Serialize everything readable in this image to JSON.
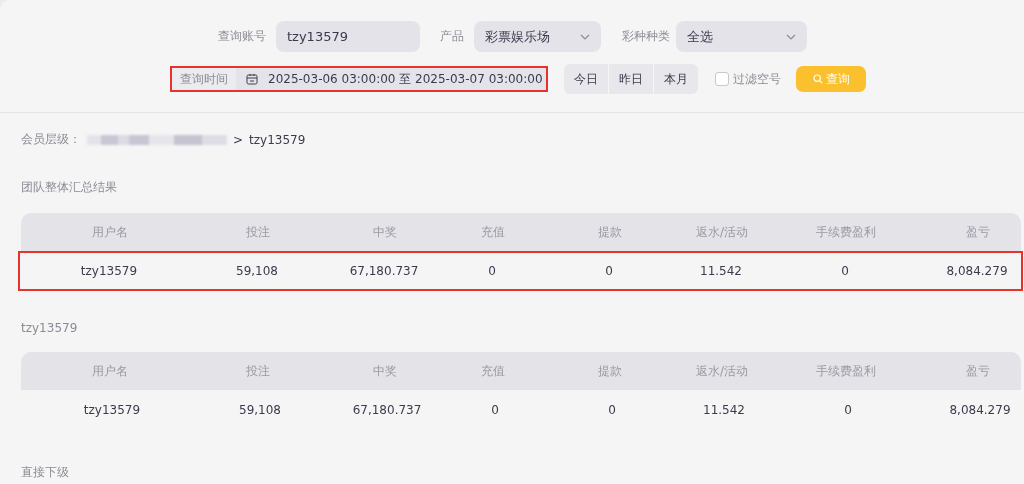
{
  "filters": {
    "account": {
      "label": "查询账号",
      "value": "tzy13579"
    },
    "product": {
      "label": "产品",
      "value": "彩票娱乐场"
    },
    "lottery_type": {
      "label": "彩种种类",
      "value": "全选"
    },
    "time": {
      "label": "查询时间",
      "value": "2025-03-06 03:00:00 至 2025-03-07 03:00:00",
      "highlighted": true
    },
    "quick_ranges": [
      {
        "label": "今日",
        "selected": false
      },
      {
        "label": "昨日",
        "selected": false
      },
      {
        "label": "本月",
        "selected": false
      }
    ],
    "filter_empty": {
      "label": "过滤空号",
      "checked": false
    },
    "search_button": "查询"
  },
  "breadcrumb": {
    "label": "会员层级：",
    "separator": ">",
    "current": "tzy13579"
  },
  "sections": [
    {
      "title": "团队整体汇总结果",
      "columns": [
        "用户名",
        "投注",
        "中奖",
        "充值",
        "提款",
        "返水/活动",
        "手续费盈利",
        "盈亏"
      ],
      "rows": [
        {
          "cells": [
            "tzy13579",
            "59,108",
            "67,180.737",
            "0",
            "0",
            "11.542",
            "0",
            "8,084.279"
          ],
          "highlighted": true
        }
      ]
    },
    {
      "title": "tzy13579",
      "columns": [
        "用户名",
        "投注",
        "中奖",
        "充值",
        "提款",
        "返水/活动",
        "手续费盈利",
        "盈亏"
      ],
      "rows": [
        {
          "cells": [
            "tzy13579",
            "59,108",
            "67,180.737",
            "0",
            "0",
            "11.542",
            "0",
            "8,084.279"
          ],
          "highlighted": false
        }
      ]
    },
    {
      "title": "直接下级"
    }
  ]
}
